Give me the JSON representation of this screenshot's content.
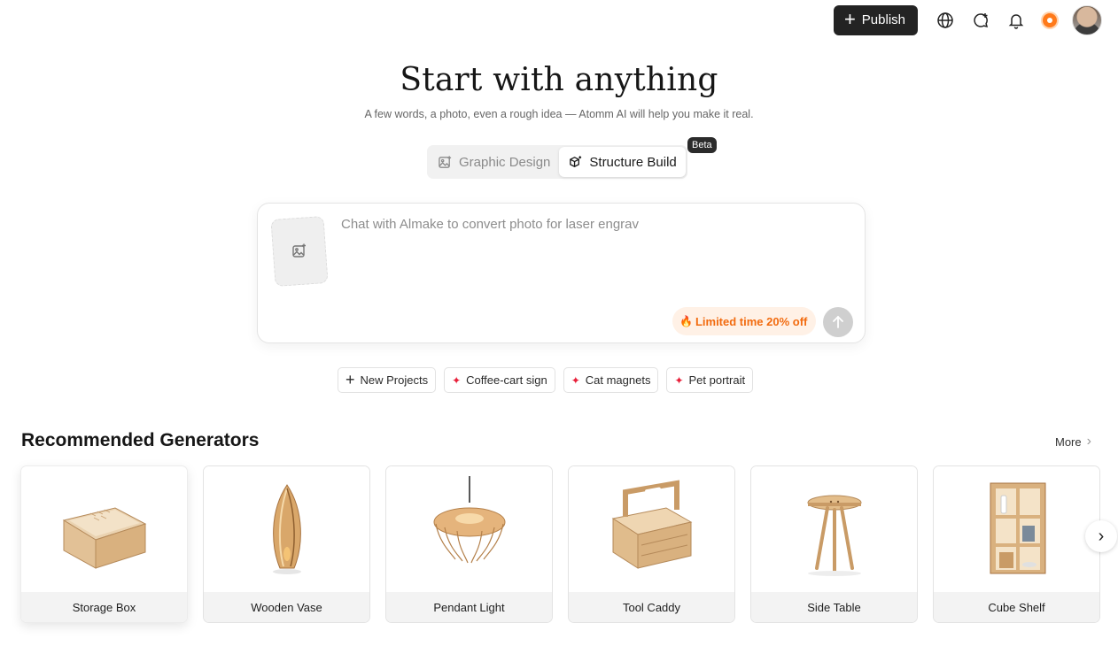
{
  "header": {
    "publish_label": "Publish",
    "icons": [
      "plus-icon",
      "globe-icon",
      "chat-add-icon",
      "bell-icon",
      "credit-icon",
      "avatar"
    ]
  },
  "hero": {
    "title": "Start with anything",
    "subtitle": "A few words, a photo, even a rough idea — Atomm AI will help you make it real."
  },
  "modes": {
    "tabs": [
      {
        "label": "Graphic Design",
        "active": false
      },
      {
        "label": "Structure Build",
        "active": true
      }
    ],
    "beta_label": "Beta"
  },
  "prompt": {
    "placeholder": "Chat with Almake to convert photo for laser engrav",
    "promo_label": "Limited time 20% off"
  },
  "suggestions": [
    {
      "label": "New Projects",
      "icon": "plus-icon"
    },
    {
      "label": "Coffee-cart sign",
      "icon": "sparkle-icon"
    },
    {
      "label": "Cat magnets",
      "icon": "sparkle-icon"
    },
    {
      "label": "Pet portrait",
      "icon": "sparkle-icon"
    }
  ],
  "recommended": {
    "title": "Recommended Generators",
    "more_label": "More",
    "cards": [
      {
        "label": "Storage Box"
      },
      {
        "label": "Wooden Vase"
      },
      {
        "label": "Pendant Light"
      },
      {
        "label": "Tool Caddy"
      },
      {
        "label": "Side Table"
      },
      {
        "label": "Cube Shelf"
      }
    ]
  },
  "colors": {
    "accent_dark": "#232323",
    "promo_orange": "#f26b0f",
    "promo_bg": "#fff1e6",
    "sparkle_red": "#e8203a",
    "wood": "#d9b17f"
  }
}
